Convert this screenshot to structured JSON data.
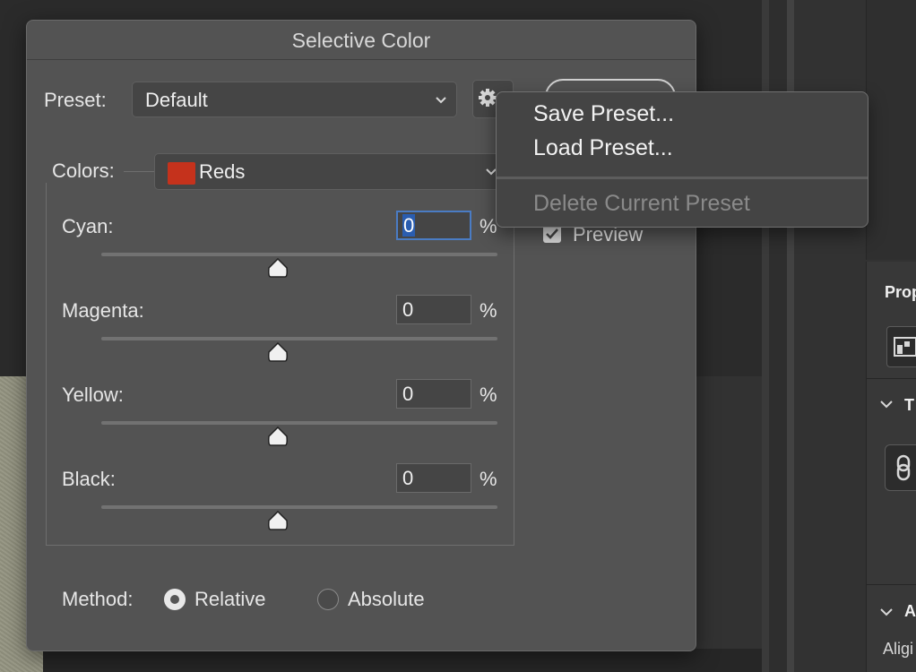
{
  "dialog": {
    "title": "Selective Color",
    "preset_label": "Preset:",
    "preset_value": "Default",
    "colors_label": "Colors:",
    "colors_value": "Reds",
    "colors_swatch": "#c5321c",
    "ok_label": "",
    "preview_label": "Preview",
    "preview_checked": true,
    "sliders": [
      {
        "label": "Cyan:",
        "value": "0",
        "unit": "%"
      },
      {
        "label": "Magenta:",
        "value": "0",
        "unit": "%"
      },
      {
        "label": "Yellow:",
        "value": "0",
        "unit": "%"
      },
      {
        "label": "Black:",
        "value": "0",
        "unit": "%"
      }
    ],
    "method_label": "Method:",
    "method_options": [
      {
        "label": "Relative",
        "selected": true
      },
      {
        "label": "Absolute",
        "selected": false
      }
    ]
  },
  "menu": {
    "items": [
      {
        "label": "Save Preset...",
        "enabled": true
      },
      {
        "label": "Load Preset...",
        "enabled": true
      },
      {
        "label": "Delete Current Preset",
        "enabled": false
      }
    ]
  },
  "right_panel": {
    "properties_label": "Prop",
    "section2_label": "T",
    "section3_label": "A",
    "align_label": "Aligi"
  },
  "icons": {
    "gear": "gear-icon",
    "chevron": "chevron-down-icon",
    "check": "checkmark-icon"
  }
}
